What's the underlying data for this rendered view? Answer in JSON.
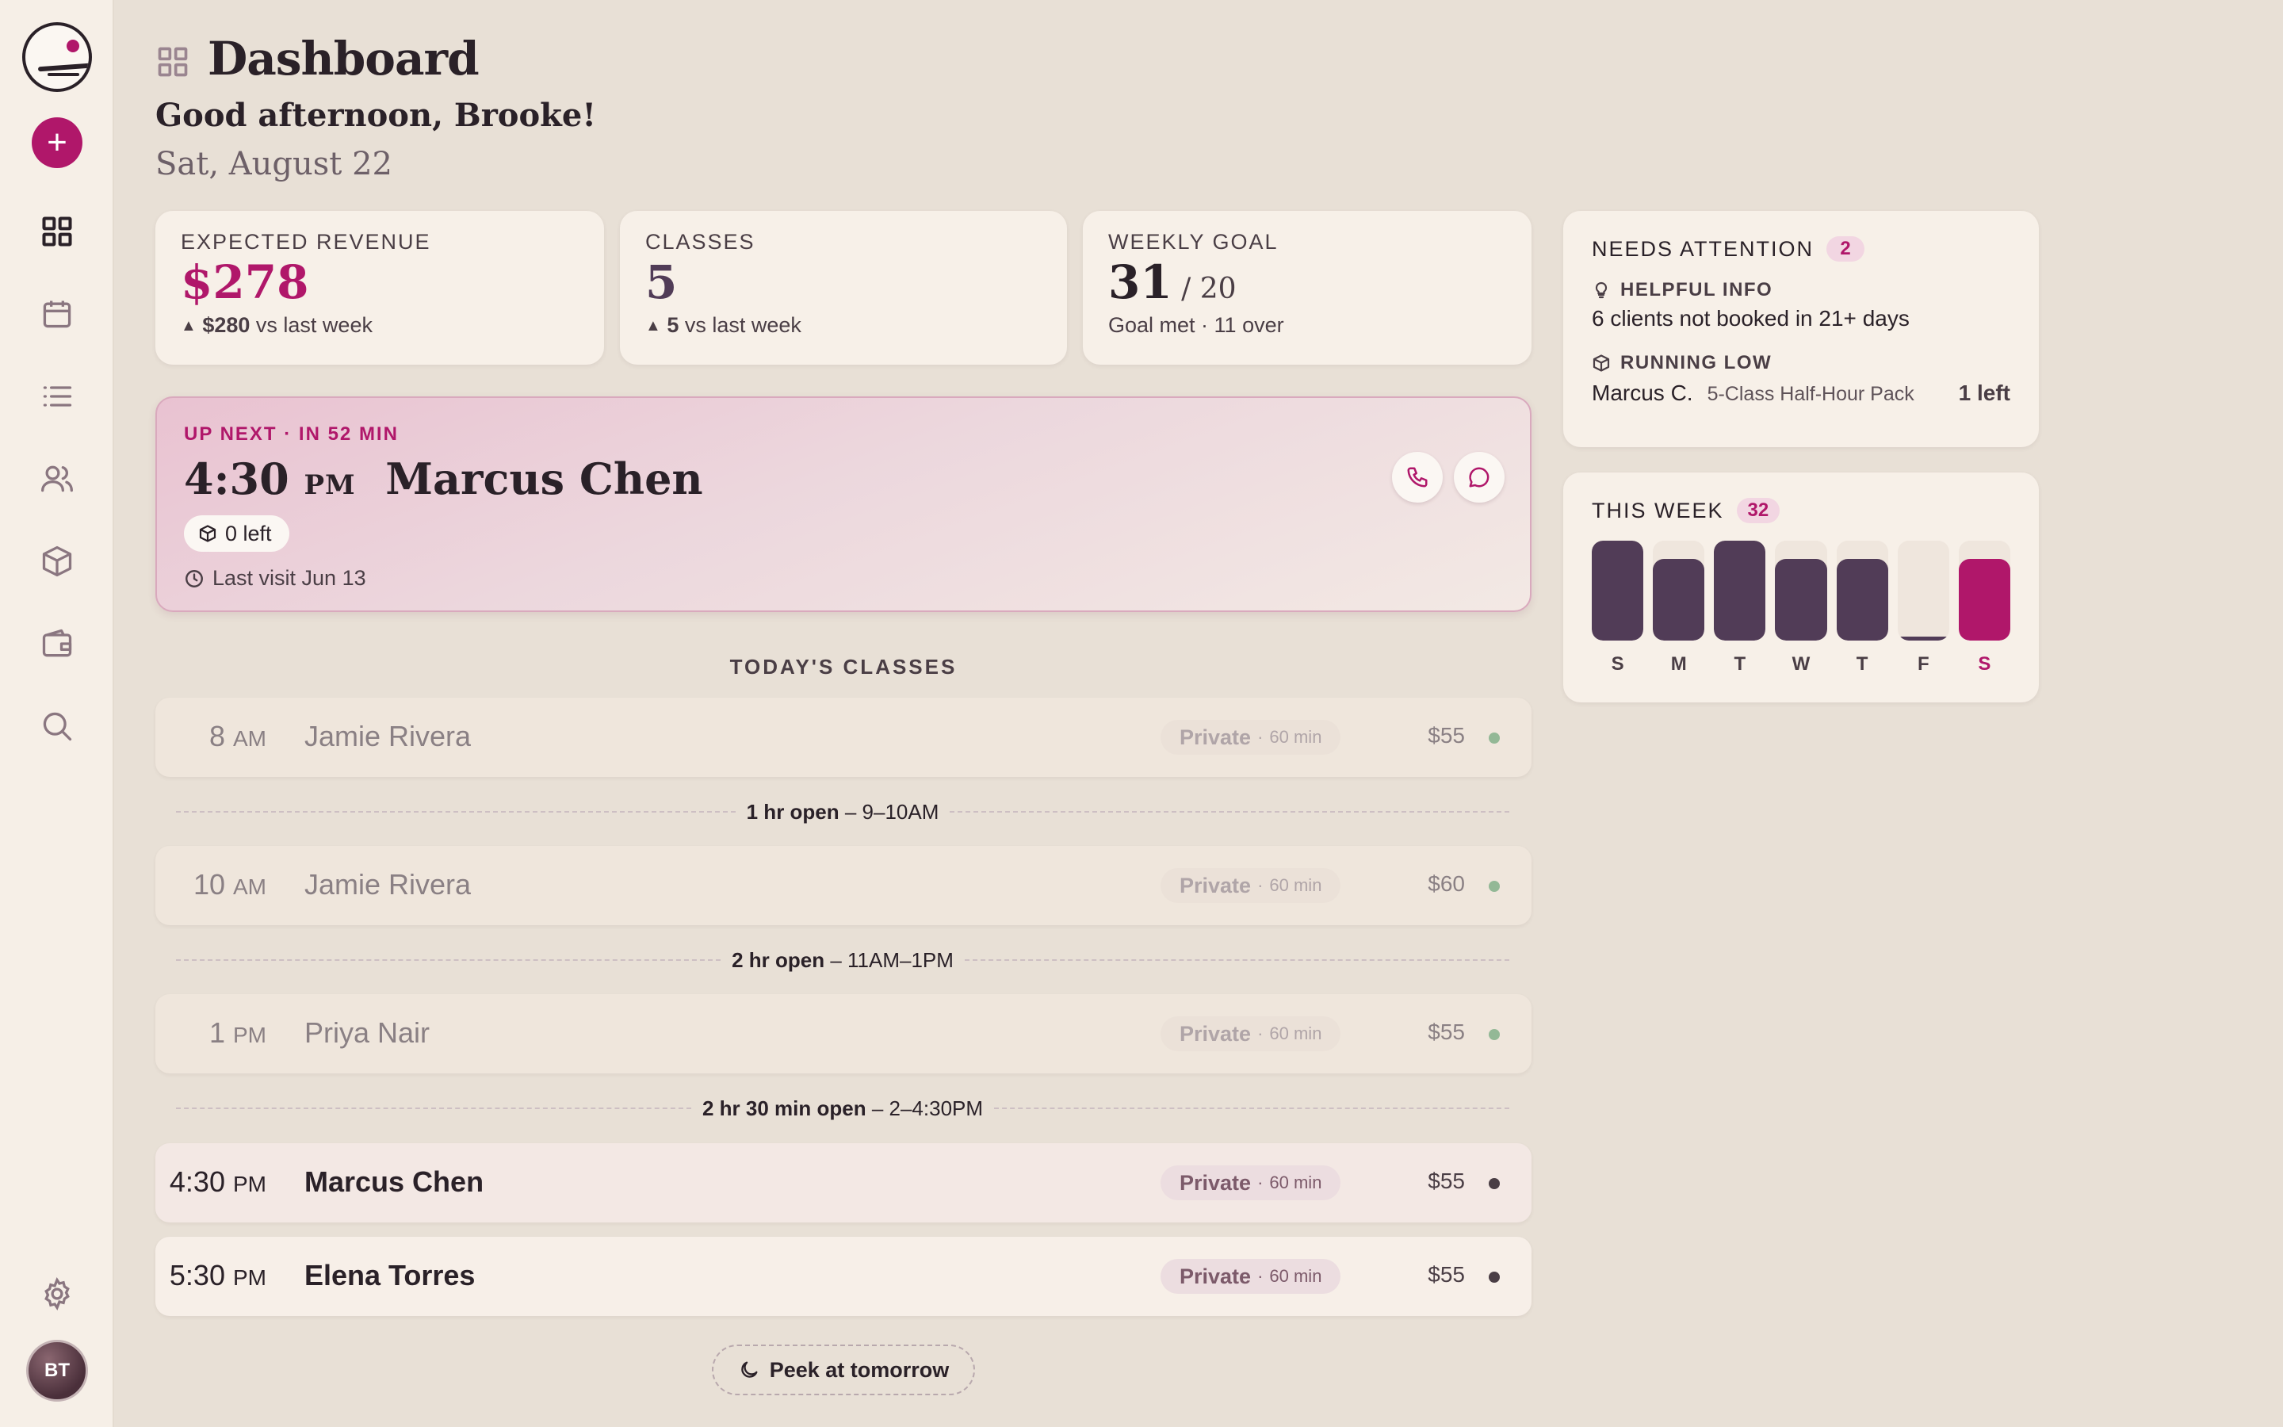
{
  "app": {
    "add_label": "+",
    "avatar_initials": "BT",
    "nav": [
      {
        "name": "dashboard",
        "icon": "grid-icon",
        "active": true
      },
      {
        "name": "calendar",
        "icon": "calendar-icon"
      },
      {
        "name": "list",
        "icon": "list-icon"
      },
      {
        "name": "clients",
        "icon": "users-icon"
      },
      {
        "name": "packages",
        "icon": "box-icon"
      },
      {
        "name": "wallet",
        "icon": "wallet-icon"
      },
      {
        "name": "search",
        "icon": "search-icon"
      },
      {
        "name": "settings",
        "icon": "gear-icon"
      }
    ],
    "accent": "#b0176a",
    "dark": "#513c57"
  },
  "header": {
    "title": "Dashboard",
    "greeting": "Good afternoon, Brooke!",
    "date": "Sat, August 22"
  },
  "stats": {
    "revenue": {
      "label": "EXPECTED REVENUE",
      "value": "$278",
      "delta": "$280",
      "delta_text": "vs last week"
    },
    "classes": {
      "label": "CLASSES",
      "value": "5",
      "delta": "5",
      "delta_text": "vs last week"
    },
    "goal": {
      "label": "WEEKLY GOAL",
      "value": "31",
      "target": "/ 20",
      "sub": "Goal met · 11 over"
    }
  },
  "up_next": {
    "label": "UP NEXT · IN 52 MIN",
    "time": "4:30",
    "period": "PM",
    "name": "Marcus Chen",
    "badge": "0 left",
    "last_visit": "Last visit Jun 13"
  },
  "today": {
    "title": "TODAY'S CLASSES",
    "classes": [
      {
        "time": "8",
        "period": "AM",
        "name": "Jamie Rivera",
        "type": "Private",
        "duration": "60 min",
        "price": "$55",
        "state": "past"
      },
      {
        "time": "10",
        "period": "AM",
        "name": "Jamie Rivera",
        "type": "Private",
        "duration": "60 min",
        "price": "$60",
        "state": "past"
      },
      {
        "time": "1",
        "period": "PM",
        "name": "Priya Nair",
        "type": "Private",
        "duration": "60 min",
        "price": "$55",
        "state": "past"
      },
      {
        "time": "4:30",
        "period": "PM",
        "name": "Marcus Chen",
        "type": "Private",
        "duration": "60 min",
        "price": "$55",
        "state": "next"
      },
      {
        "time": "5:30",
        "period": "PM",
        "name": "Elena Torres",
        "type": "Private",
        "duration": "60 min",
        "price": "$55",
        "state": "upcoming"
      }
    ],
    "gaps": [
      {
        "bold": "1 hr open",
        "range": " – 9–10AM"
      },
      {
        "bold": "2 hr open",
        "range": " – 11AM–1PM"
      },
      {
        "bold": "2 hr 30 min open",
        "range": " – 2–4:30PM"
      }
    ],
    "peek_label": "Peek at tomorrow"
  },
  "attention": {
    "title": "NEEDS ATTENTION",
    "count": "2",
    "helpful_title": "HELPFUL INFO",
    "helpful_text": "6 clients not booked in 21+ days",
    "low_title": "RUNNING LOW",
    "low_client": "Marcus C.",
    "low_pack": "5-Class Half-Hour Pack",
    "low_left": "1 left"
  },
  "this_week": {
    "title": "THIS WEEK",
    "count": "32",
    "days": [
      "S",
      "M",
      "T",
      "W",
      "T",
      "F",
      "S"
    ],
    "levels": [
      1.0,
      0.82,
      1.0,
      0.82,
      0.82,
      0.04,
      0.82
    ],
    "today_index": 6
  }
}
